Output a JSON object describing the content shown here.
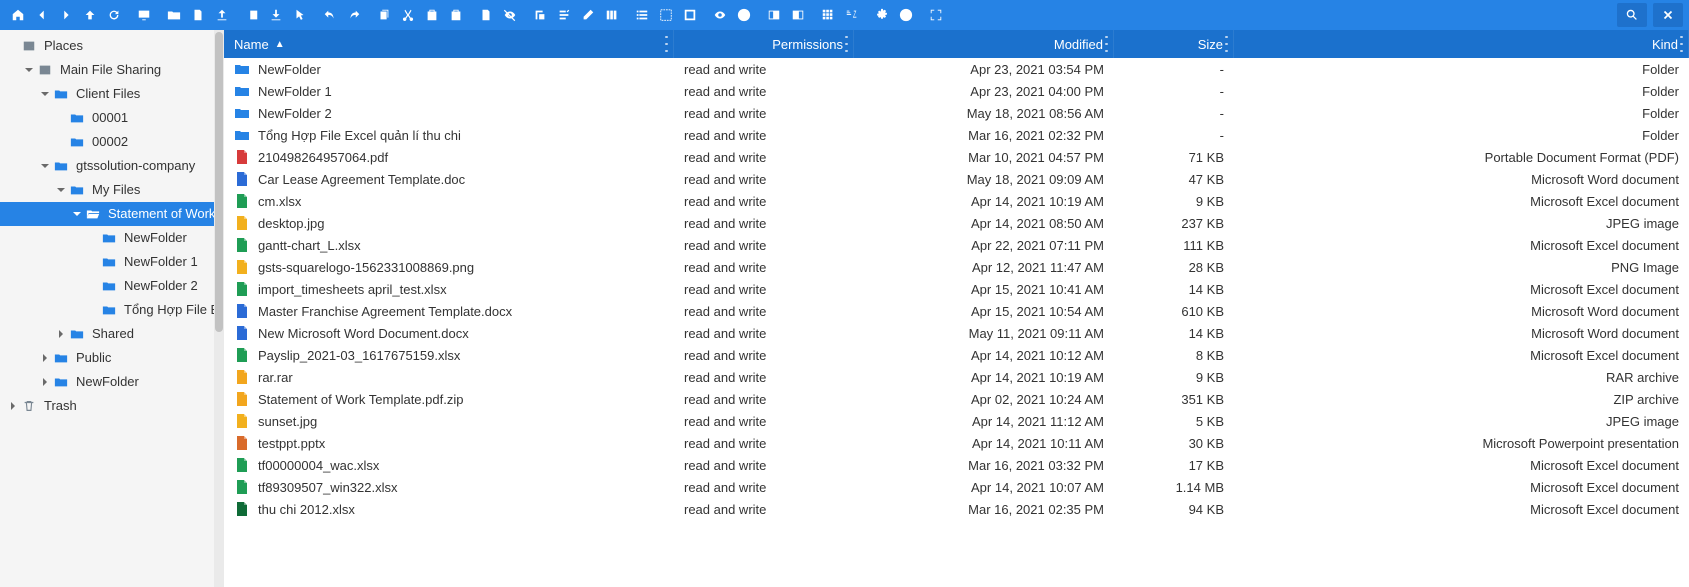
{
  "toolbar_icons": [
    "home",
    "back",
    "forward",
    "up",
    "refresh",
    "sep",
    "monitor",
    "sep",
    "new-folder",
    "new-file",
    "upload",
    "sep",
    "panel",
    "download",
    "cursor",
    "sep",
    "undo",
    "redo",
    "sep",
    "copy",
    "cut",
    "paste",
    "clipboard",
    "sep",
    "new-doc",
    "eye-off",
    "sep",
    "copy-path",
    "rename",
    "edit",
    "columns",
    "sep",
    "list-view",
    "select-all",
    "invert-selection",
    "sep",
    "preview",
    "info",
    "sep",
    "pane-1",
    "pane-2",
    "sep",
    "grid-icons",
    "sort-az",
    "sep",
    "settings",
    "help",
    "sep",
    "fullscreen"
  ],
  "sidebar": {
    "root": "Places",
    "trash": "Trash",
    "items": [
      {
        "depth": 0,
        "caret": "none",
        "icon": "disk",
        "label": "Places"
      },
      {
        "depth": 1,
        "caret": "down",
        "icon": "disk",
        "label": "Main File Sharing"
      },
      {
        "depth": 2,
        "caret": "down",
        "icon": "folder",
        "label": "Client Files"
      },
      {
        "depth": 3,
        "caret": "none",
        "icon": "folder",
        "label": "00001"
      },
      {
        "depth": 3,
        "caret": "none",
        "icon": "folder",
        "label": "00002"
      },
      {
        "depth": 2,
        "caret": "down",
        "icon": "folder",
        "label": "gtssolution-company"
      },
      {
        "depth": 3,
        "caret": "down",
        "icon": "folder",
        "label": "My Files"
      },
      {
        "depth": 4,
        "caret": "down",
        "icon": "folder-open",
        "label": "Statement of Work",
        "selected": true
      },
      {
        "depth": 5,
        "caret": "none",
        "icon": "folder",
        "label": "NewFolder"
      },
      {
        "depth": 5,
        "caret": "none",
        "icon": "folder",
        "label": "NewFolder 1"
      },
      {
        "depth": 5,
        "caret": "none",
        "icon": "folder",
        "label": "NewFolder 2"
      },
      {
        "depth": 5,
        "caret": "none",
        "icon": "folder",
        "label": "Tổng Hợp File Excel quản lí thu chi"
      },
      {
        "depth": 3,
        "caret": "right",
        "icon": "folder",
        "label": "Shared"
      },
      {
        "depth": 2,
        "caret": "right",
        "icon": "folder",
        "label": "Public"
      },
      {
        "depth": 2,
        "caret": "right",
        "icon": "folder",
        "label": "NewFolder"
      },
      {
        "depth": 0,
        "caret": "right",
        "icon": "trash",
        "label": "Trash"
      }
    ]
  },
  "columns": {
    "name": "Name",
    "permissions": "Permissions",
    "modified": "Modified",
    "size": "Size",
    "kind": "Kind"
  },
  "files": [
    {
      "icon": "folder",
      "name": "NewFolder",
      "perm": "read and write",
      "mod": "Apr 23, 2021 03:54 PM",
      "size": "-",
      "kind": "Folder"
    },
    {
      "icon": "folder",
      "name": "NewFolder 1",
      "perm": "read and write",
      "mod": "Apr 23, 2021 04:00 PM",
      "size": "-",
      "kind": "Folder"
    },
    {
      "icon": "folder",
      "name": "NewFolder 2",
      "perm": "read and write",
      "mod": "May 18, 2021 08:56 AM",
      "size": "-",
      "kind": "Folder"
    },
    {
      "icon": "folder",
      "name": "Tổng Hợp File Excel quản lí thu chi",
      "perm": "read and write",
      "mod": "Mar 16, 2021 02:32 PM",
      "size": "-",
      "kind": "Folder"
    },
    {
      "icon": "pdf",
      "name": "210498264957064.pdf",
      "perm": "read and write",
      "mod": "Mar 10, 2021 04:57 PM",
      "size": "71 KB",
      "kind": "Portable Document Format (PDF)"
    },
    {
      "icon": "doc",
      "name": "Car Lease Agreement Template.doc",
      "perm": "read and write",
      "mod": "May 18, 2021 09:09 AM",
      "size": "47 KB",
      "kind": "Microsoft Word document"
    },
    {
      "icon": "xls",
      "name": "cm.xlsx",
      "perm": "read and write",
      "mod": "Apr 14, 2021 10:19 AM",
      "size": "9 KB",
      "kind": "Microsoft Excel document"
    },
    {
      "icon": "img",
      "name": "desktop.jpg",
      "perm": "read and write",
      "mod": "Apr 14, 2021 08:50 AM",
      "size": "237 KB",
      "kind": "JPEG image"
    },
    {
      "icon": "xls",
      "name": "gantt-chart_L.xlsx",
      "perm": "read and write",
      "mod": "Apr 22, 2021 07:11 PM",
      "size": "111 KB",
      "kind": "Microsoft Excel document"
    },
    {
      "icon": "img",
      "name": "gsts-squarelogo-1562331008869.png",
      "perm": "read and write",
      "mod": "Apr 12, 2021 11:47 AM",
      "size": "28 KB",
      "kind": "PNG Image"
    },
    {
      "icon": "xls",
      "name": "import_timesheets april_test.xlsx",
      "perm": "read and write",
      "mod": "Apr 15, 2021 10:41 AM",
      "size": "14 KB",
      "kind": "Microsoft Excel document"
    },
    {
      "icon": "doc",
      "name": "Master Franchise Agreement Template.docx",
      "perm": "read and write",
      "mod": "Apr 15, 2021 10:54 AM",
      "size": "610 KB",
      "kind": "Microsoft Word document"
    },
    {
      "icon": "doc",
      "name": "New Microsoft Word Document.docx",
      "perm": "read and write",
      "mod": "May 11, 2021 09:11 AM",
      "size": "14 KB",
      "kind": "Microsoft Word document"
    },
    {
      "icon": "xls",
      "name": "Payslip_2021-03_1617675159.xlsx",
      "perm": "read and write",
      "mod": "Apr 14, 2021 10:12 AM",
      "size": "8 KB",
      "kind": "Microsoft Excel document"
    },
    {
      "icon": "zip",
      "name": "rar.rar",
      "perm": "read and write",
      "mod": "Apr 14, 2021 10:19 AM",
      "size": "9 KB",
      "kind": "RAR archive"
    },
    {
      "icon": "zip",
      "name": "Statement of Work Template.pdf.zip",
      "perm": "read and write",
      "mod": "Apr 02, 2021 10:24 AM",
      "size": "351 KB",
      "kind": "ZIP archive"
    },
    {
      "icon": "img",
      "name": "sunset.jpg",
      "perm": "read and write",
      "mod": "Apr 14, 2021 11:12 AM",
      "size": "5 KB",
      "kind": "JPEG image"
    },
    {
      "icon": "ppt",
      "name": "testppt.pptx",
      "perm": "read and write",
      "mod": "Apr 14, 2021 10:11 AM",
      "size": "30 KB",
      "kind": "Microsoft Powerpoint presentation"
    },
    {
      "icon": "xls",
      "name": "tf00000004_wac.xlsx",
      "perm": "read and write",
      "mod": "Mar 16, 2021 03:32 PM",
      "size": "17 KB",
      "kind": "Microsoft Excel document"
    },
    {
      "icon": "xls",
      "name": "tf89309507_win322.xlsx",
      "perm": "read and write",
      "mod": "Apr 14, 2021 10:07 AM",
      "size": "1.14 MB",
      "kind": "Microsoft Excel document"
    },
    {
      "icon": "xlsg",
      "name": "thu chi 2012.xlsx",
      "perm": "read and write",
      "mod": "Mar 16, 2021 02:35 PM",
      "size": "94 KB",
      "kind": "Microsoft Excel document"
    }
  ]
}
